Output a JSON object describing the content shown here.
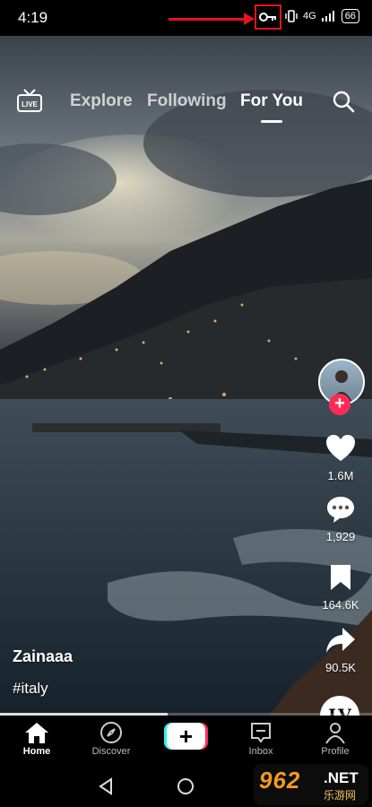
{
  "status_bar": {
    "time": "4:19",
    "network": "4G",
    "battery": "66"
  },
  "top_nav": {
    "tabs": [
      "Explore",
      "Following",
      "For You"
    ],
    "active_tab": "For You"
  },
  "actions": {
    "likes": "1.6M",
    "comments": "1,929",
    "saves": "164.6K",
    "shares": "90.5K",
    "sound_label": "LV"
  },
  "caption": {
    "username": "Zainaaa",
    "hashtag": "#italy"
  },
  "video_progress": 0.45,
  "bottom_tabs": [
    "Home",
    "Discover",
    "Inbox",
    "Profile"
  ],
  "watermark": {
    "brand": "962",
    "domain": ".NET",
    "chinese": "乐游网"
  },
  "colors": {
    "accent_red": "#fe2c55",
    "accent_cyan": "#25f4ee",
    "annotation_red": "#e3141b"
  }
}
